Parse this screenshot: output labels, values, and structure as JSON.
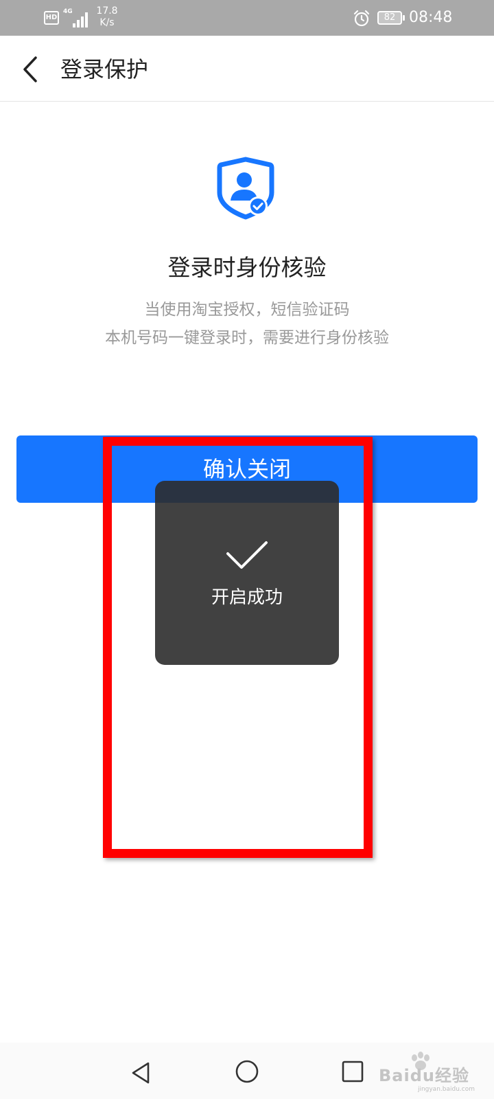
{
  "status_bar": {
    "hd": "HD",
    "network": "4G",
    "speed_value": "17.8",
    "speed_unit": "K/s",
    "battery": "82",
    "time": "08:48"
  },
  "header": {
    "title": "登录保护"
  },
  "content": {
    "title": "登录时身份核验",
    "description_line1": "当使用淘宝授权，短信验证码",
    "description_line2": "本机号码一键登录时，需要进行身份核验",
    "confirm_button_label": "确认关闭"
  },
  "toast": {
    "message": "开启成功"
  },
  "watermark": {
    "text": "Baidu经验",
    "subtext": "jingyan.baidu.com"
  },
  "colors": {
    "accent": "#1776ff",
    "highlight": "#ff0000",
    "toast_bg": "#2c2c2c",
    "status_bar_bg": "#a9a9a9"
  },
  "icons": {
    "back": "chevron-left-icon",
    "shield": "shield-user-check-icon",
    "toast": "check-icon",
    "nav_back": "triangle-back-icon",
    "nav_home": "circle-home-icon",
    "nav_recents": "square-recents-icon"
  }
}
